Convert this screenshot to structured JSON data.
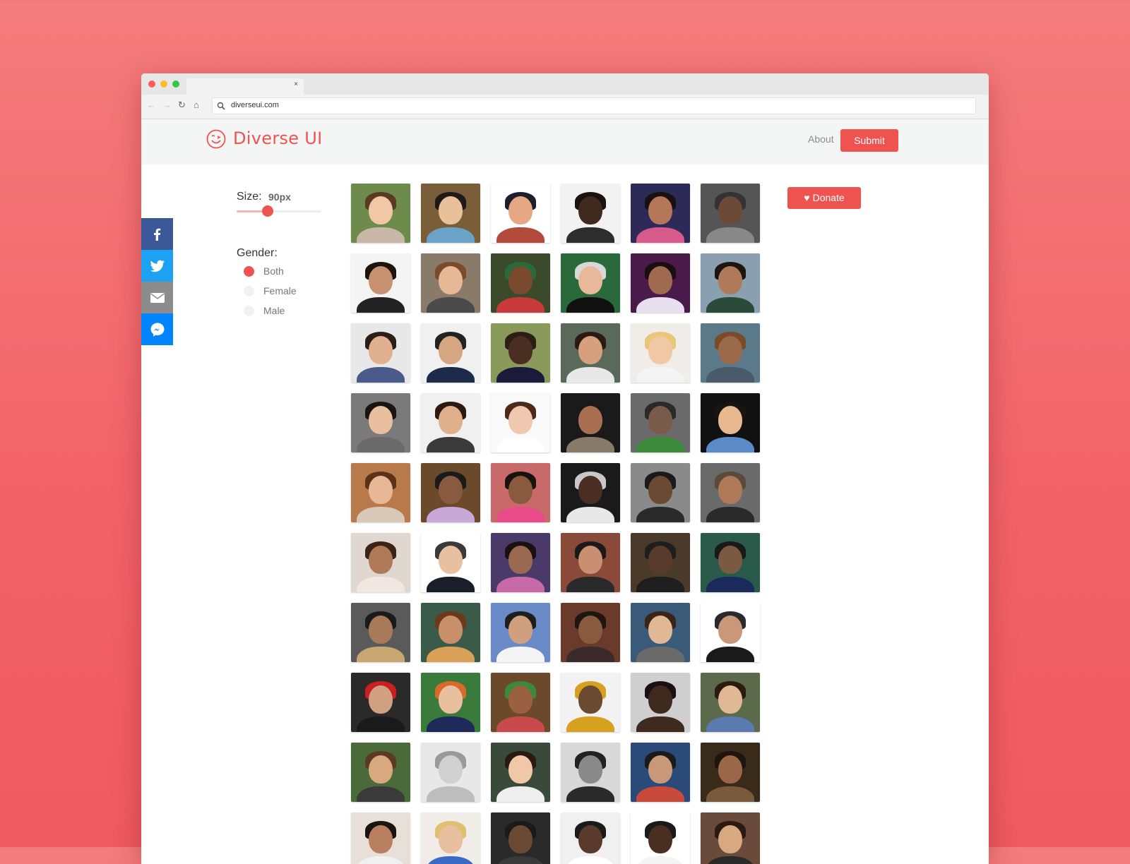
{
  "browser": {
    "url": "diverseui.com",
    "tab_close": "×"
  },
  "header": {
    "logo_text": "Diverse UI",
    "about_label": "About",
    "submit_label": "Submit"
  },
  "social": [
    "facebook",
    "twitter",
    "email",
    "messenger"
  ],
  "controls": {
    "size_label": "Size:",
    "size_value": "90px",
    "size_slider_fraction": 0.37,
    "gender_label": "Gender:",
    "gender_options": [
      {
        "label": "Both",
        "checked": true
      },
      {
        "label": "Female",
        "checked": false
      },
      {
        "label": "Male",
        "checked": false
      }
    ]
  },
  "donate": {
    "label": "Donate"
  },
  "colors": {
    "accent": "#ef5350",
    "facebook": "#3b5998",
    "twitter": "#1da1f2",
    "email": "#8c8c8c",
    "messenger": "#0084ff"
  },
  "avatars": [
    {
      "bg": "#6d8b4a",
      "skin": "#f0c8a8",
      "hair": "#5a3a22",
      "shirt": "#c9b8a8"
    },
    {
      "bg": "#7a5e3a",
      "skin": "#e8c09a",
      "hair": "#1f1a16",
      "shirt": "#6aa2c8"
    },
    {
      "bg": "#ffffff",
      "skin": "#e6a882",
      "hair": "#1e1e2c",
      "shirt": "#b44a3a"
    },
    {
      "bg": "#f2f2f2",
      "skin": "#3e2a1e",
      "hair": "#1a120e",
      "shirt": "#2d2d2d"
    },
    {
      "bg": "#2d2a5a",
      "skin": "#b5775a",
      "hair": "#1a1010",
      "shirt": "#d65a8a"
    },
    {
      "bg": "#555555",
      "skin": "#6b4a38",
      "hair": "#333333",
      "shirt": "#888888"
    },
    {
      "bg": "#f4f4f4",
      "skin": "#c89270",
      "hair": "#1e140e",
      "shirt": "#222222"
    },
    {
      "bg": "#8a7a6a",
      "skin": "#e6b896",
      "hair": "#7a4a2a",
      "shirt": "#4a4a4a"
    },
    {
      "bg": "#3a4a2a",
      "skin": "#7a4a2e",
      "hair": "#2a6a3a",
      "shirt": "#c83a3a"
    },
    {
      "bg": "#2a6a3a",
      "skin": "#e8b89a",
      "hair": "#d8d8d8",
      "shirt": "#111111"
    },
    {
      "bg": "#4a1a4a",
      "skin": "#a06a50",
      "hair": "#1a0e0e",
      "shirt": "#e8e0f0"
    },
    {
      "bg": "#8aa0b0",
      "skin": "#b07a5a",
      "hair": "#1e1410",
      "shirt": "#2a4a3a"
    },
    {
      "bg": "#e8e8e8",
      "skin": "#e0b090",
      "hair": "#2a1e16",
      "shirt": "#4a5a8a"
    },
    {
      "bg": "#f0f0f0",
      "skin": "#d6a682",
      "hair": "#222222",
      "shirt": "#1e2a4a"
    },
    {
      "bg": "#8a9a5a",
      "skin": "#4a2e22",
      "hair": "#2a1e16",
      "shirt": "#1a1a3a"
    },
    {
      "bg": "#5a6a5a",
      "skin": "#d6a07e",
      "hair": "#2a1a12",
      "shirt": "#e8e8e8"
    },
    {
      "bg": "#f0ece8",
      "skin": "#f0c8a6",
      "hair": "#e8c878",
      "shirt": "#f4f4f4"
    },
    {
      "bg": "#5a7a8a",
      "skin": "#9a6a4a",
      "hair": "#7a4a2a",
      "shirt": "#4a5a6a"
    },
    {
      "bg": "#7a7a7a",
      "skin": "#e8c0a0",
      "hair": "#1a1410",
      "shirt": "#6a6a6a"
    },
    {
      "bg": "#f0f0f0",
      "skin": "#e0b08a",
      "hair": "#2a1a10",
      "shirt": "#3a3a3a"
    },
    {
      "bg": "#fafafa",
      "skin": "#f0c8b0",
      "hair": "#4a2a1a",
      "shirt": "#ffffff"
    },
    {
      "bg": "#1a1a1a",
      "skin": "#a87050",
      "hair": "#1a1a1a",
      "shirt": "#8a7a6a"
    },
    {
      "bg": "#6a6a6a",
      "skin": "#7a5a48",
      "hair": "#2a2a2a",
      "shirt": "#3a8a3a"
    },
    {
      "bg": "#111111",
      "skin": "#e8b890",
      "hair": "#1a1410",
      "shirt": "#5a8ac8"
    },
    {
      "bg": "#b87a4a",
      "skin": "#e8b896",
      "hair": "#5a3218",
      "shirt": "#d8c8b8"
    },
    {
      "bg": "#6a4a2a",
      "skin": "#8a5a40",
      "hair": "#1a1a1a",
      "shirt": "#c8a8d8"
    },
    {
      "bg": "#c86a6a",
      "skin": "#8a5a3e",
      "hair": "#1a120e",
      "shirt": "#e84a8a"
    },
    {
      "bg": "#1a1a1a",
      "skin": "#4a2e22",
      "hair": "#c8c8c8",
      "shirt": "#e8e8e8"
    },
    {
      "bg": "#8a8a8a",
      "skin": "#6a4a32",
      "hair": "#1a1a1a",
      "shirt": "#2a2a2a"
    },
    {
      "bg": "#6a6a6a",
      "skin": "#b07a58",
      "hair": "#5a4a3a",
      "shirt": "#2a2a2a"
    },
    {
      "bg": "#e0d8d0",
      "skin": "#b07a5a",
      "hair": "#3a2418",
      "shirt": "#f0e8e0"
    },
    {
      "bg": "#ffffff",
      "skin": "#e8c0a0",
      "hair": "#3a3a3a",
      "shirt": "#1a1e2a"
    },
    {
      "bg": "#4a3a6a",
      "skin": "#9a6a50",
      "hair": "#1a1010",
      "shirt": "#c86aa8"
    },
    {
      "bg": "#8a4a3a",
      "skin": "#c89070",
      "hair": "#1a1a1a",
      "shirt": "#2a2a2a"
    },
    {
      "bg": "#4a3a2a",
      "skin": "#5a3a2a",
      "hair": "#1e1e1e",
      "shirt": "#1e1e1e"
    },
    {
      "bg": "#2a5a4a",
      "skin": "#7a5a42",
      "hair": "#1a1a1a",
      "shirt": "#1a2a5a"
    },
    {
      "bg": "#5a5a5a",
      "skin": "#a87a5a",
      "hair": "#1a1a1a",
      "shirt": "#c8a870"
    },
    {
      "bg": "#3a5a4a",
      "skin": "#c8906a",
      "hair": "#6a3a1a",
      "shirt": "#d8a058"
    },
    {
      "bg": "#6a8ac8",
      "skin": "#d0a07e",
      "hair": "#1e1e1e",
      "shirt": "#f4f4f4"
    },
    {
      "bg": "#6a3a2a",
      "skin": "#8a5a3e",
      "hair": "#1e1410",
      "shirt": "#3a2a2a"
    },
    {
      "bg": "#3a5a7a",
      "skin": "#e0b896",
      "hair": "#3a2418",
      "shirt": "#6a6a6a"
    },
    {
      "bg": "#ffffff",
      "skin": "#c89878",
      "hair": "#2a2a2a",
      "shirt": "#1a1a1a"
    },
    {
      "bg": "#2a2a2a",
      "skin": "#d0a080",
      "hair": "#c82020",
      "shirt": "#1a1a1a"
    },
    {
      "bg": "#3a7a3a",
      "skin": "#e8c0a0",
      "hair": "#d86a2a",
      "shirt": "#1e2a5a"
    },
    {
      "bg": "#6a4a2a",
      "skin": "#9a6040",
      "hair": "#3a8a3a",
      "shirt": "#c84a4a"
    },
    {
      "bg": "#f2f2f2",
      "skin": "#6a4a30",
      "hair": "#d8a020",
      "shirt": "#d8a020"
    },
    {
      "bg": "#cfcfcf",
      "skin": "#3e2a1e",
      "hair": "#1a1010",
      "shirt": "#3e2a1e"
    },
    {
      "bg": "#5a6a4a",
      "skin": "#e0b896",
      "hair": "#2a1a10",
      "shirt": "#5a7ab0"
    },
    {
      "bg": "#4a6a3a",
      "skin": "#d8a880",
      "hair": "#5a3a22",
      "shirt": "#3a3a3a"
    },
    {
      "bg": "#e8e8e8",
      "skin": "#d0d0d0",
      "hair": "#9a9a9a",
      "shirt": "#bdbdbd"
    },
    {
      "bg": "#3a4a3a",
      "skin": "#f0c8a8",
      "hair": "#2a1a12",
      "shirt": "#eeeeee"
    },
    {
      "bg": "#d8d8d8",
      "skin": "#8a8a8a",
      "hair": "#222222",
      "shirt": "#2a2a2a"
    },
    {
      "bg": "#2a4a7a",
      "skin": "#c89878",
      "hair": "#1a1a1a",
      "shirt": "#c84a3a"
    },
    {
      "bg": "#3a2a1a",
      "skin": "#9a6848",
      "hair": "#1e1410",
      "shirt": "#7a5a3a"
    },
    {
      "bg": "#e8e0d8",
      "skin": "#b88060",
      "hair": "#1a1410",
      "shirt": "#f0f0f0"
    },
    {
      "bg": "#f0ede8",
      "skin": "#e8c0a0",
      "hair": "#e0c070",
      "shirt": "#3a6ac8"
    },
    {
      "bg": "#2a2a2a",
      "skin": "#6a4a32",
      "hair": "#1a1a1a",
      "shirt": "#3a3a3a"
    },
    {
      "bg": "#f0f0f0",
      "skin": "#5a3a2a",
      "hair": "#1a1a1a",
      "shirt": "#ffffff"
    },
    {
      "bg": "#ffffff",
      "skin": "#4a2e22",
      "hair": "#1a1a1a",
      "shirt": "#f4f4f4"
    },
    {
      "bg": "#6a4a3a",
      "skin": "#d8a880",
      "hair": "#2a1a12",
      "shirt": "#2a2a2a"
    }
  ]
}
